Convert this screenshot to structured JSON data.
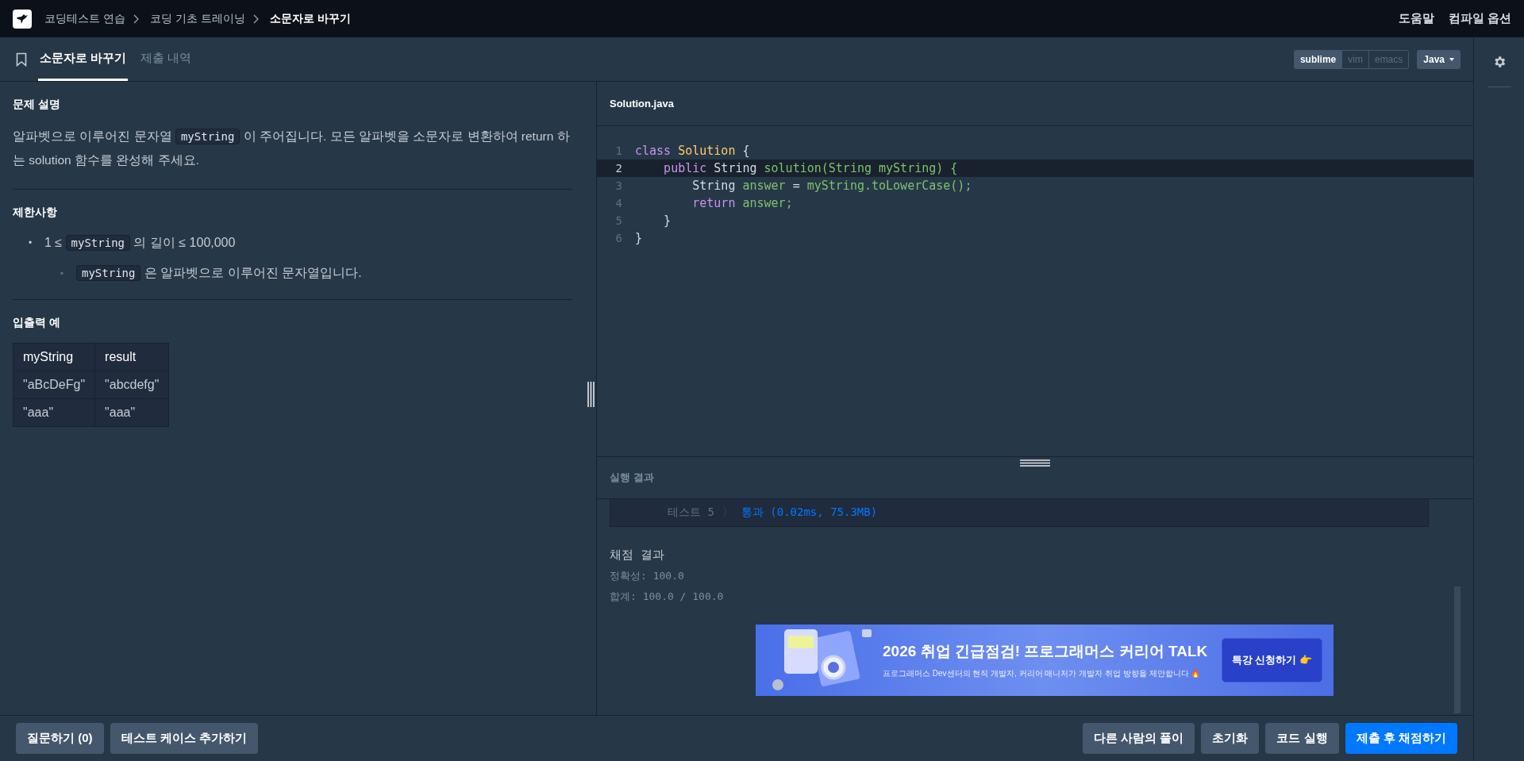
{
  "breadcrumb": [
    {
      "label": "코딩테스트 연습",
      "current": false
    },
    {
      "label": "코딩 기초 트레이닝",
      "current": false
    },
    {
      "label": "소문자로 바꾸기",
      "current": true
    }
  ],
  "top_links": [
    "도움말",
    "컴파일 옵션"
  ],
  "tabs": [
    {
      "label": "소문자로 바꾸기",
      "selected": true
    },
    {
      "label": "제출 내역",
      "selected": false
    }
  ],
  "keymaps": [
    {
      "label": "sublime",
      "selected": true
    },
    {
      "label": "vim",
      "selected": false
    },
    {
      "label": "emacs",
      "selected": false
    }
  ],
  "language": "Java",
  "problem": {
    "description_title": "문제 설명",
    "description": [
      {
        "kind": "text",
        "text": "알파벳으로 이루어진 문자열 "
      },
      {
        "kind": "code",
        "text": "myString"
      },
      {
        "kind": "text",
        "text": " 이 주어집니다. 모든 알파벳을 소문자로 변환하여 return 하는 solution 함수를 완성해 주세요."
      }
    ],
    "constraints_title": "제한사항",
    "constraints": [
      {
        "marker": "•",
        "segments": [
          {
            "kind": "text",
            "text": "1 ≤ "
          },
          {
            "kind": "code",
            "text": "myString"
          },
          {
            "kind": "text",
            "text": " 의 길이 ≤ 100,000"
          }
        ],
        "children": [
          {
            "marker": "◦",
            "segments": [
              {
                "kind": "code",
                "text": "myString"
              },
              {
                "kind": "text",
                "text": " 은 알파벳으로 이루어진 문자열입니다."
              }
            ]
          }
        ]
      }
    ],
    "examples_title": "입출력 예",
    "table": {
      "columns": [
        "myString",
        "result"
      ],
      "rows": [
        [
          "\"aBcDeFg\"",
          "\"abcdefg\""
        ],
        [
          "\"aaa\"",
          "\"aaa\""
        ]
      ]
    }
  },
  "editor": {
    "file": "Solution.java",
    "lines": [
      {
        "number": "1",
        "current": false,
        "tokens": [
          {
            "kind": "keyword",
            "text": "class"
          },
          {
            "kind": "type",
            "text": "Solution"
          },
          {
            "kind": "plain",
            "text": "{"
          }
        ]
      },
      {
        "number": "2",
        "current": true,
        "tokens": [
          {
            "kind": "keyword",
            "text": "    public"
          },
          {
            "kind": "plain",
            "text": "String"
          },
          {
            "kind": "name",
            "text": "solution(String"
          },
          {
            "kind": "name",
            "text": "myString) {"
          }
        ]
      },
      {
        "number": "3",
        "current": false,
        "tokens": [
          {
            "kind": "plain",
            "text": "        String"
          },
          {
            "kind": "name",
            "text": "answer"
          },
          {
            "kind": "plain",
            "text": "="
          },
          {
            "kind": "name",
            "text": "myString.toLowerCase();"
          }
        ]
      },
      {
        "number": "4",
        "current": false,
        "tokens": [
          {
            "kind": "keyword",
            "text": "        return"
          },
          {
            "kind": "name",
            "text": "answer;"
          }
        ]
      },
      {
        "number": "5",
        "current": false,
        "tokens": [
          {
            "kind": "plain",
            "text": "    }"
          }
        ]
      },
      {
        "number": "6",
        "current": false,
        "tokens": [
          {
            "kind": "plain",
            "text": "}"
          }
        ]
      }
    ]
  },
  "result": {
    "title": "실행 결과",
    "tests": [
      {
        "label": "테스트 5",
        "separator": "〉",
        "outcome": "통과 (0.02ms, 75.3MB)"
      }
    ],
    "grading_title": "채점 결과",
    "grading": [
      "정확성: 100.0",
      "합계: 100.0 / 100.0"
    ]
  },
  "banner": {
    "headline": "2026 취업 긴급점검! 프로그래머스 커리어 TALK",
    "subtext": "프로그래머스 Dev센터의 현직 개발자, 커리어 매니저가 개발자 취업 방향을 제안합니다 🔥",
    "button": "특강 신청하기 👉"
  },
  "bottom_left": [
    "질문하기 (0)",
    "테스트 케이스 추가하기"
  ],
  "bottom_right": [
    {
      "label": "다른 사람의 풀이",
      "kind": "secondary"
    },
    {
      "label": "초기화",
      "kind": "secondary"
    },
    {
      "label": "코드 실행",
      "kind": "secondary"
    },
    {
      "label": "제출 후 채점하기",
      "kind": "primary"
    }
  ]
}
